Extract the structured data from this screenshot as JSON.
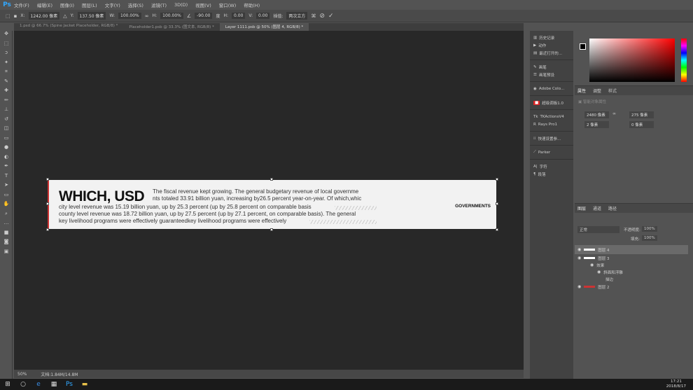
{
  "app": {
    "logo": "Ps"
  },
  "menu": [
    "文件(F)",
    "编辑(E)",
    "图像(I)",
    "图层(L)",
    "文字(Y)",
    "选择(S)",
    "滤镜(T)",
    "3D(D)",
    "视图(V)",
    "窗口(W)",
    "帮助(H)"
  ],
  "options": {
    "x_label": "X:",
    "x": "1242.00 像素",
    "y_label": "Y:",
    "y": "137.50 像素",
    "w_label": "W:",
    "w": "100.00%",
    "h_label": "H:",
    "h": "100.00%",
    "angle": "-90.00",
    "angle_unit": "度",
    "hskew_label": "H:",
    "hskew": "0.00",
    "vskew_label": "V:",
    "vskew": "0.00",
    "interp_label": "插值:",
    "interp": "两次立方"
  },
  "tabs": [
    "1.psd @ 66.7% (Spine Jacket Placeholder, RGB/8) *",
    "Placeholder1.psb @ 33.3% (图文本, RGB/8) *",
    "Layer 1111.psb @ 50% (图层 4, RGB/8) *"
  ],
  "artboard": {
    "headline": "WHICH, USD",
    "lines": [
      "The fiscal revenue kept growing. The general budgetary revenue of local governme",
      "nts totaled 33.91 billion yuan, increasing by26.5 percent year-on-year. Of which,whic",
      "city level revenue was 15.19 billion yuan, up by 25.3 percent (up by 25.8 percent on comparable basis",
      "county level revenue was 18.72 billion yuan, up by 27.5 percent (up by 27.1 percent, on comparable basis). The general",
      "key livelihood programs were effectively guaranteedkey livelihood programs were effectively"
    ],
    "tag": "GOVERNMENTS"
  },
  "status": {
    "zoom": "50%",
    "doc": "文档:1.84M/14.8M"
  },
  "dock": [
    "历史记录",
    "动作",
    "最近打开的...",
    "画笔",
    "画笔预设",
    "Adobe Colo...",
    "超级调板1.0",
    "TKActionsV4",
    "Rays Pro1",
    "快速设置参...",
    "Parker",
    "字符",
    "段落"
  ],
  "properties": {
    "tabs": [
      "属性",
      "调整",
      "样式"
    ],
    "title": "智能对象属性",
    "w": "2480 像素",
    "h": "275 像素",
    "x": "2 像素",
    "y": "0 像素"
  },
  "layers": {
    "tabs": [
      "图层",
      "通道",
      "路径"
    ],
    "blend": "正常",
    "opacity_label": "不透明度:",
    "opacity": "100%",
    "fill_label": "填充:",
    "fill": "100%",
    "items": [
      "图层 4",
      "图层 3",
      "效果",
      "斜面和浮雕",
      "描边",
      "图层 2"
    ]
  },
  "taskbar": {
    "time": "17:21",
    "date": "2018/8/17"
  }
}
